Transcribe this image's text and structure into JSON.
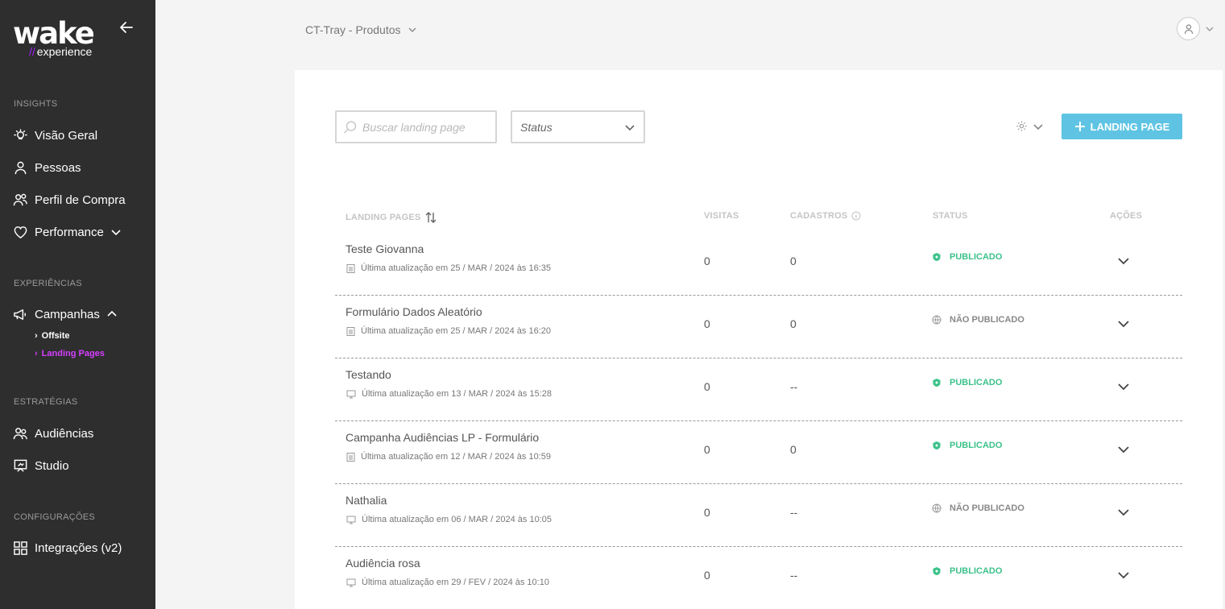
{
  "sidebar": {
    "logo_main": "wake",
    "logo_sub": "experience",
    "sections": {
      "insights": "INSIGHTS",
      "experiencias": "EXPERIÊNCIAS",
      "estrategias": "ESTRATÉGIAS",
      "configuracoes": "CONFIGURAÇÕES"
    },
    "items": {
      "visao_geral": "Visão Geral",
      "pessoas": "Pessoas",
      "perfil_compra": "Perfil de Compra",
      "performance": "Performance",
      "campanhas": "Campanhas",
      "offsite": "Offsite",
      "landing_pages": "Landing Pages",
      "audiencias": "Audiências",
      "studio": "Studio",
      "integracoes": "Integrações (v2)"
    }
  },
  "header": {
    "store": "CT-Tray - Produtos"
  },
  "toolbar": {
    "search_placeholder": "Buscar landing page",
    "status_label": "Status",
    "add_label": "LANDING PAGE"
  },
  "table": {
    "columns": {
      "name": "LANDING PAGES",
      "visits": "VISITAS",
      "signups": "CADASTROS",
      "status": "STATUS",
      "actions": "AÇÕES"
    },
    "rows": [
      {
        "name": "Teste Giovanna",
        "meta": "Última atualização em 25 / MAR / 2024 às 16:35",
        "visits": "0",
        "signups": "0",
        "status": "PUBLICADO"
      },
      {
        "name": "Formulário Dados Aleatório",
        "meta": "Última atualização em 25 / MAR / 2024 às 16:20",
        "visits": "0",
        "signups": "0",
        "status": "NÃO PUBLICADO"
      },
      {
        "name": "Testando",
        "meta": "Última atualização em 13 / MAR / 2024 às 15:28",
        "visits": "0",
        "signups": "--",
        "status": "PUBLICADO"
      },
      {
        "name": "Campanha Audiências LP - Formulário",
        "meta": "Última atualização em 12 / MAR / 2024 às 10:59",
        "visits": "0",
        "signups": "0",
        "status": "PUBLICADO"
      },
      {
        "name": "Nathalia",
        "meta": "Última atualização em 06 / MAR / 2024 às 10:05",
        "visits": "0",
        "signups": "--",
        "status": "NÃO PUBLICADO"
      },
      {
        "name": "Audiência rosa",
        "meta": "Última atualização em 29 / FEV / 2024 às 10:10",
        "visits": "0",
        "signups": "--",
        "status": "PUBLICADO"
      }
    ]
  },
  "colors": {
    "sidebar_bg": "#2e2e2e",
    "brand_purple": "#a51cff",
    "active_link": "#d63fff",
    "primary_button": "#5fc4e3",
    "published": "#3cc28a"
  }
}
